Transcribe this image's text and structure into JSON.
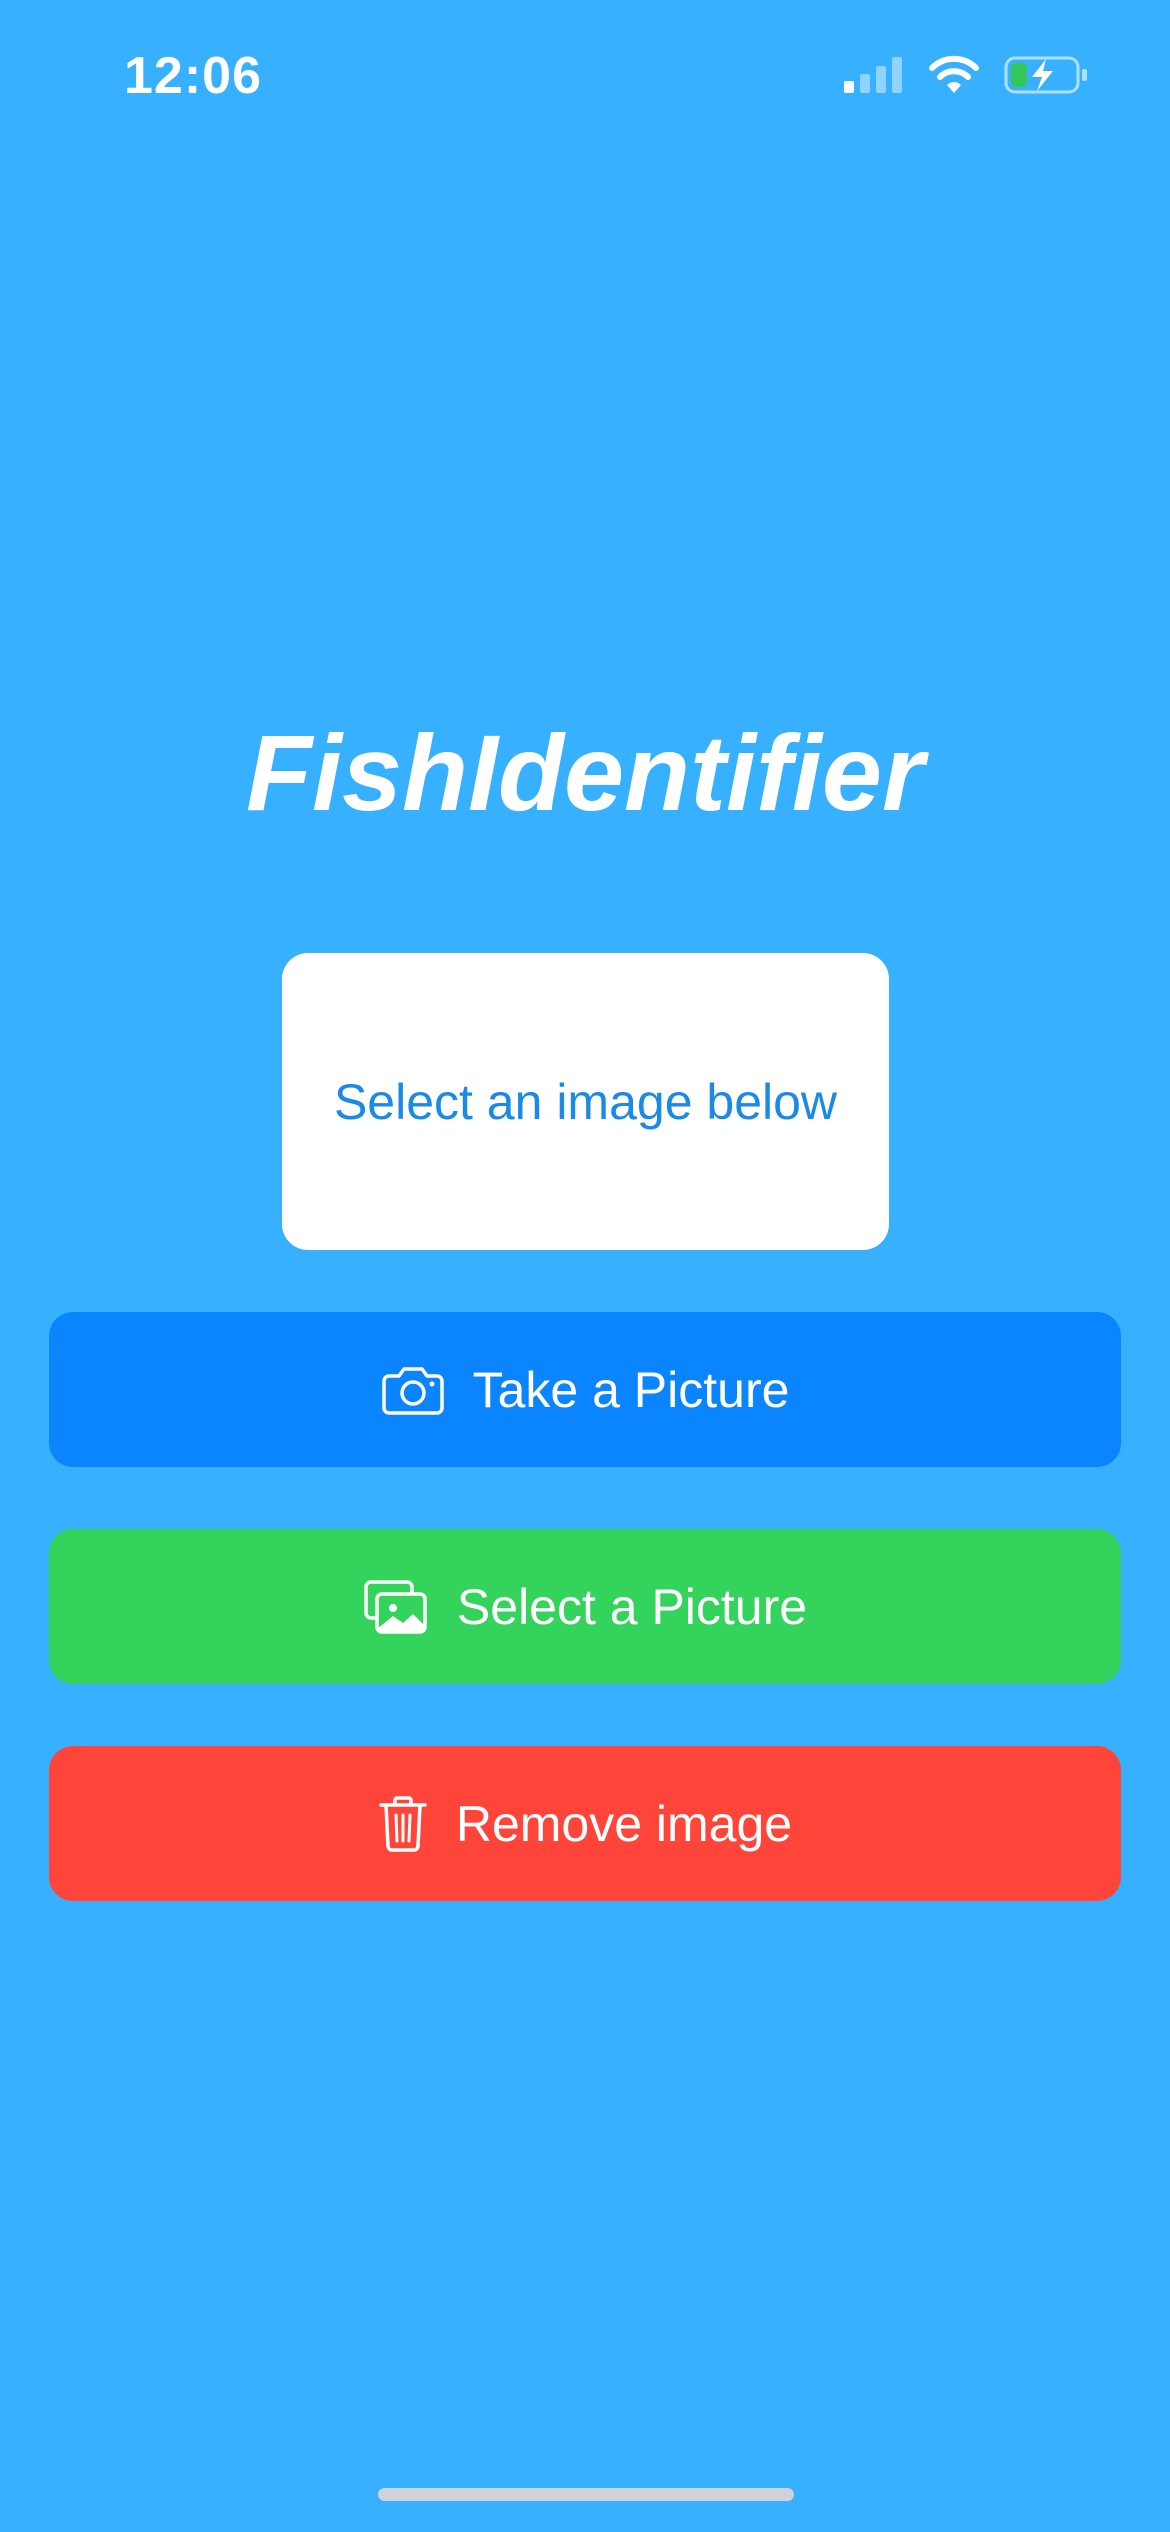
{
  "status_bar": {
    "time": "12:06",
    "icons": [
      "cellular-signal-icon",
      "wifi-icon",
      "battery-charging-icon"
    ]
  },
  "app": {
    "title": "FishIdentifier"
  },
  "image_box": {
    "placeholder": "Select an image below"
  },
  "buttons": [
    {
      "label": "Take a Picture",
      "icon": "camera-icon",
      "color": "#0b84ff"
    },
    {
      "label": "Select a Picture",
      "icon": "photo-library-icon",
      "color": "#33d35c"
    },
    {
      "label": "Remove image",
      "icon": "trash-icon",
      "color": "#ff453a"
    }
  ],
  "colors": {
    "background": "#36b0ff",
    "placeholder_text": "#1a8ae6",
    "battery_fill": "#34c759"
  }
}
